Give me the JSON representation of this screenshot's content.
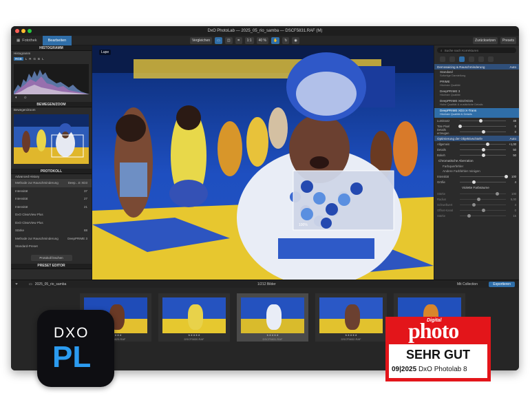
{
  "window": {
    "title": "DxO PhotoLab — 2025_05_rio_samba — DSCF5831.RAF (M)"
  },
  "toolbar": {
    "tab_library": "Fotothek",
    "tab_edit": "Bearbeiten",
    "compare": "Vergleichen",
    "zoom": "40 %",
    "ratio": "1:1",
    "reset": "Zurücksetzen",
    "presets": "Presets"
  },
  "left_panel": {
    "histogram": {
      "title": "HISTOGRAMM",
      "label": "Histogramm",
      "channels": [
        "RGB",
        "L",
        "R",
        "G",
        "B",
        "L"
      ]
    },
    "zoom": {
      "title": "BEWEGEN/ZOOM",
      "label": "Bewegen/Zoom"
    },
    "protocol": {
      "title": "PROTOKOLL",
      "subtitle": "Advanced History",
      "items": [
        {
          "label": "Methode zur Rauschminderung",
          "value": "Deep…E XD3"
        },
        {
          "label": "Intensität",
          "value": "37"
        },
        {
          "label": "Intensität",
          "value": "27"
        },
        {
          "label": "Intensität",
          "value": "21"
        },
        {
          "label": "DxO ClearView Plus",
          "value": ""
        },
        {
          "label": "DxO ClearView Plus",
          "value": ""
        },
        {
          "label": "Stärke",
          "value": "88"
        },
        {
          "label": "Methode zur Rauschminderung",
          "value": "DeepPRIME 3"
        },
        {
          "label": "Standard-Preset",
          "value": ""
        }
      ],
      "button": "Protokoll löschen"
    },
    "preset_editor": "PRESET EDITOR"
  },
  "viewer": {
    "loupe_label": "Lupe",
    "zoom_percent": "100%"
  },
  "right_panel": {
    "search_placeholder": "Suche nach Korrekturen",
    "noise_header": "Demosaicing & Rauschminderung",
    "noise_auto": "Auto",
    "options": [
      {
        "name": "Standard",
        "desc": "Sofortige Darstellung"
      },
      {
        "name": "PRIME",
        "desc": "Höchste Qualität"
      },
      {
        "name": "DeepPRIME 3",
        "desc": "Höchste Qualität"
      },
      {
        "name": "DeepPRIME XD2/XD2s",
        "desc": "Hohe Qualität & zusätzliche Details"
      },
      {
        "name": "DeepPRIME XD3 X-Trans",
        "desc": "Höchste Qualität & Details"
      }
    ],
    "sliders_noise": [
      {
        "label": "Luminanz",
        "value": "48",
        "level": 0.45
      },
      {
        "label": "Tote Pixel",
        "value": "0",
        "level": 0.0
      },
      {
        "label": "Details erzeugen",
        "value": "0",
        "level": 0.5
      }
    ],
    "optics_header": "Optimierung der Objektivschärfe",
    "optics_auto": "Auto",
    "sliders_optics": [
      {
        "label": "Allgemein",
        "value": "+1,00",
        "level": 0.6
      },
      {
        "label": "Details",
        "value": "50",
        "level": 0.5
      },
      {
        "label": "Bokeh",
        "value": "50",
        "level": 0.5
      }
    ],
    "chroma": "Chromatische Aberration",
    "chroma_items": [
      "Farbquerfehler",
      "Andere Farbfehler reinigen"
    ],
    "sliders_chroma": [
      {
        "label": "Intensität",
        "value": "100",
        "level": 1.0
      },
      {
        "label": "Größe",
        "value": "4",
        "level": 0.3
      }
    ],
    "purple_fringe": "Violette Farbsäume",
    "sliders_more": [
      {
        "label": "Stärke",
        "value": "100",
        "level": 0.8
      },
      {
        "label": "Radius",
        "value": "5,00",
        "level": 0.4
      },
      {
        "label": "Schwellwert",
        "value": "4",
        "level": 0.3
      },
      {
        "label": "Offset-Kanal",
        "value": "0",
        "level": 0.5
      },
      {
        "label": "Stärke",
        "value": "15",
        "level": 0.2
      }
    ]
  },
  "filmstrip": {
    "folder": "2025_05_rio_samba",
    "count": "1/212 Bilder",
    "collection_btn": "Mit Collection",
    "export_btn": "Exportieren",
    "thumbnails": [
      {
        "name": "DSCF5829.RAF",
        "stars": "★★★★★"
      },
      {
        "name": "DSCF5830.RAF",
        "stars": "★★★★★"
      },
      {
        "name": "DSCF5831.RAF",
        "stars": "★★★★★"
      },
      {
        "name": "DSCF5832.RAF",
        "stars": "★★★★★"
      },
      {
        "name": "DSCF5833.RAF",
        "stars": "★★★★★"
      }
    ]
  },
  "logo": {
    "dxo": "DXO",
    "pl": "PL",
    "accent": "#2b9bf0"
  },
  "badge": {
    "digital": "Digital",
    "photo": "photo",
    "rating": "SEHR GUT",
    "issue": "09|2025",
    "product": "DxO Photolab 8",
    "color": "#e3151a"
  }
}
